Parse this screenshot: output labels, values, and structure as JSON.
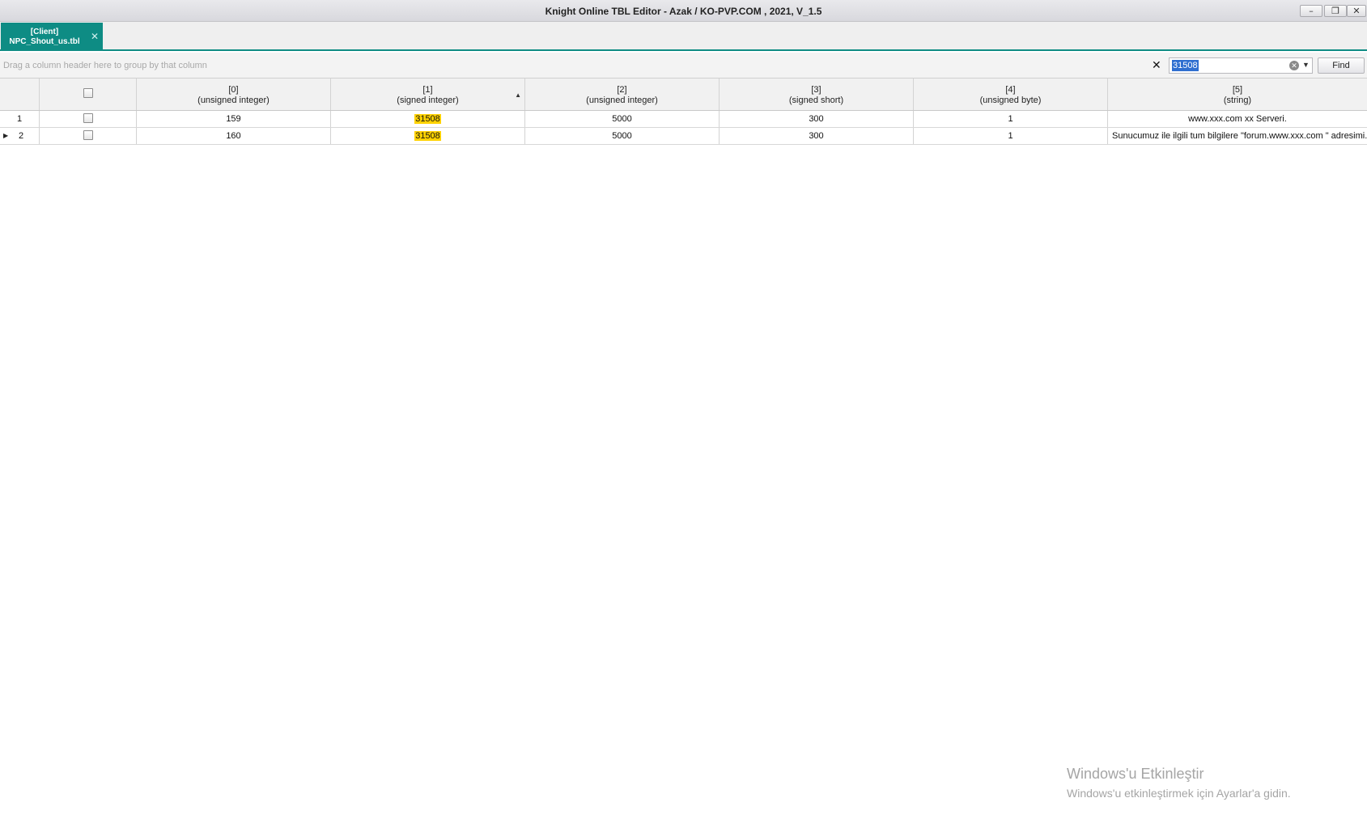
{
  "window": {
    "title": "Knight Online TBL Editor - Azak / KO-PVP.COM , 2021, V_1.5",
    "minimize": "–",
    "restore": "❐",
    "close": "✕"
  },
  "tab": {
    "line1": "[Client]",
    "line2": "NPC_Shout_us.tbl",
    "close": "✕"
  },
  "group_panel": {
    "hint": "Drag a column header here to group by that column"
  },
  "find": {
    "close_glyph": "✕",
    "value": "31508",
    "clear_glyph": "✕",
    "dropdown_glyph": "▼",
    "button": "Find"
  },
  "grid": {
    "columns": [
      {
        "index": "[0]",
        "type": "(unsigned integer)"
      },
      {
        "index": "[1]",
        "type": "(signed integer)",
        "sort": "▲"
      },
      {
        "index": "[2]",
        "type": "(unsigned integer)"
      },
      {
        "index": "[3]",
        "type": "(signed short)"
      },
      {
        "index": "[4]",
        "type": "(unsigned byte)"
      },
      {
        "index": "[5]",
        "type": "(string)"
      }
    ],
    "rows": [
      {
        "num": "1",
        "c0": "159",
        "c1": "31508",
        "c2": "5000",
        "c3": "300",
        "c4": "1",
        "c5": "www.xxx.com  xx Serveri."
      },
      {
        "num": "2",
        "indicator": "▶",
        "c0": "160",
        "c1": "31508",
        "c2": "5000",
        "c3": "300",
        "c4": "1",
        "c5": "Sunucumuz ile ilgili tum bilgilere \"forum.www.xxx.com \" adresimi..."
      }
    ]
  },
  "watermark": {
    "title": "Windows'u Etkinleştir",
    "subtitle": "Windows'u etkinleştirmek için Ayarlar'a gidin."
  },
  "colors": {
    "accent": "#0e8c84",
    "highlight": "#ffd200",
    "selection": "#2f6fd0"
  }
}
